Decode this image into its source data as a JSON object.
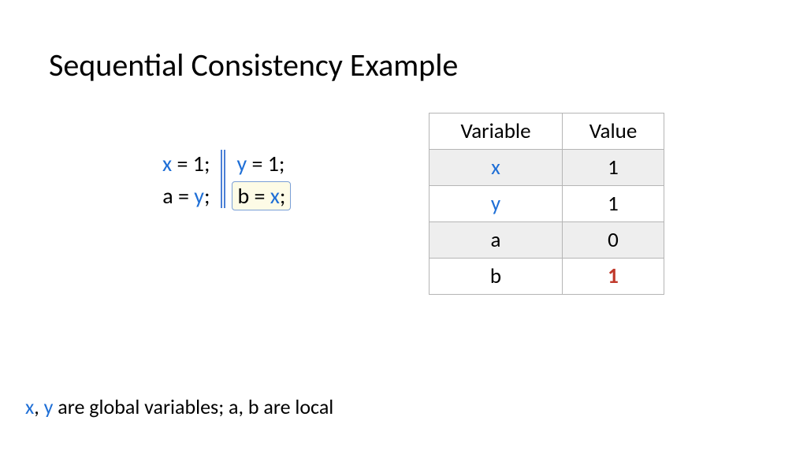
{
  "title": "Sequential Consistency Example",
  "code": {
    "left": {
      "stmt1": {
        "var": "x",
        "rest": " = 1;"
      },
      "stmt2": {
        "lhs": "a = ",
        "var": "y",
        "semi": ";"
      }
    },
    "right": {
      "stmt1": {
        "var": "y",
        "rest": " = 1;"
      },
      "stmt2": {
        "lhs": "b = ",
        "var": "x",
        "semi": ";"
      }
    }
  },
  "table": {
    "headers": {
      "variable": "Variable",
      "value": "Value"
    },
    "rows": [
      {
        "variable": "x",
        "value": "1",
        "var_blue": true,
        "shade": true
      },
      {
        "variable": "y",
        "value": "1",
        "var_blue": true,
        "shade": false
      },
      {
        "variable": "a",
        "value": "0",
        "var_blue": false,
        "shade": true
      },
      {
        "variable": "b",
        "value": "1",
        "var_blue": false,
        "shade": false,
        "value_red": true
      }
    ]
  },
  "footnote": {
    "x": "x",
    "sep": ", ",
    "y": "y",
    "rest": " are global variables; a, b are local"
  }
}
